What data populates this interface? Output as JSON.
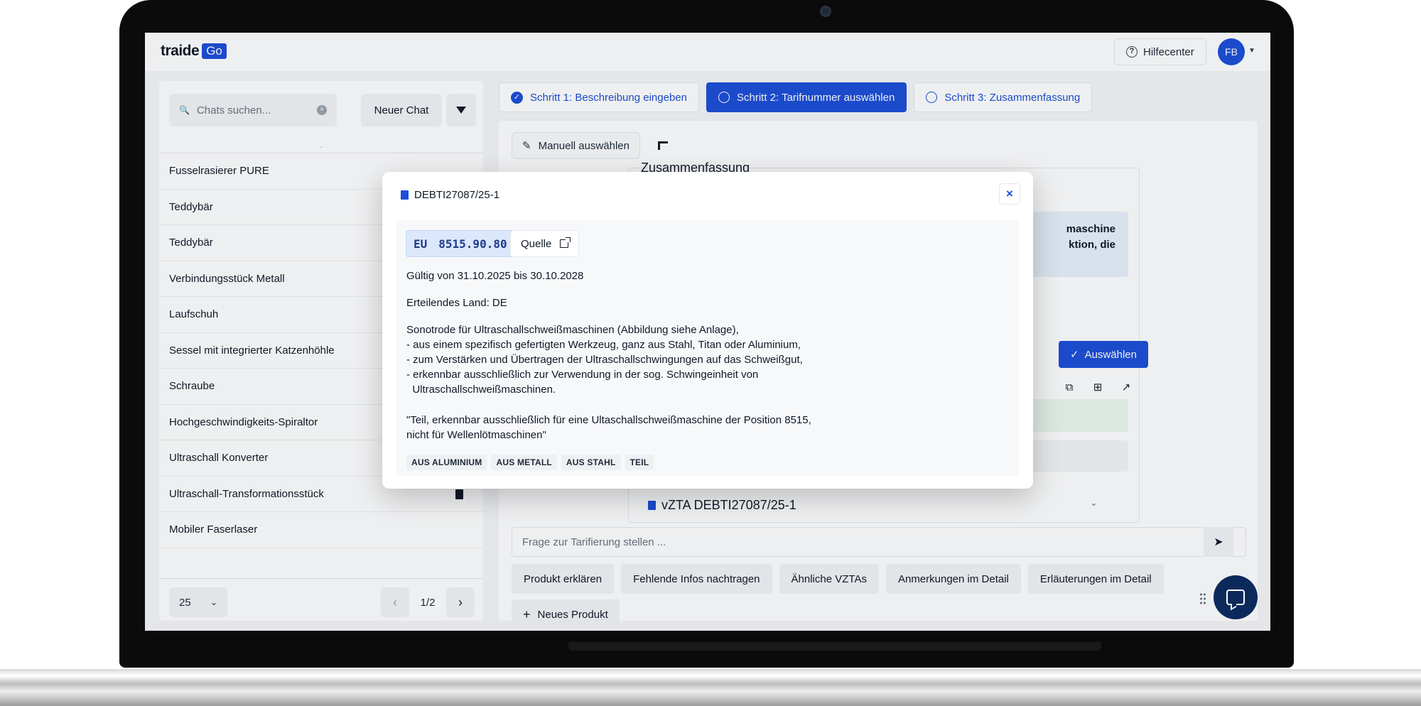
{
  "app": {
    "logo_text": "traide",
    "logo_badge": "Go"
  },
  "topbar": {
    "help_label": "Hilfecenter",
    "help_icon": "help-circle-icon",
    "avatar_initials": "FB"
  },
  "sidebar": {
    "search_placeholder": "Chats suchen...",
    "new_chat_label": "Neuer Chat",
    "chats": [
      "Fusselrasierer PURE",
      "Teddybär",
      "Teddybär",
      "Verbindungsstück Metall",
      "Laufschuh",
      "Sessel mit integrierter Katzenhöhle",
      "Schraube",
      "Hochgeschwindigkeits-Spiraltor",
      "Ultraschall Konverter",
      "Ultraschall-Transformationsstück",
      "Mobiler Faserlaser"
    ],
    "page_size": "25",
    "pagination": "1/2"
  },
  "steps": [
    {
      "label": "Schritt 1: Beschreibung eingeben",
      "state": "done"
    },
    {
      "label": "Schritt 2: Tarifnummer auswählen",
      "state": "active"
    },
    {
      "label": "Schritt 3: Zusammenfassung",
      "state": "pending"
    }
  ],
  "main": {
    "manual_select_label": "Manuell auswählen",
    "summary_heading": "Zusammenfassung",
    "blue_box_text": "maschine\nktion, die",
    "select_label": "Auswählen",
    "vzta_label": "vZTA DEBTI27087/25-1",
    "chat_input_placeholder": "Frage zur Tarifierung stellen ...",
    "suggestions": [
      "Produkt erklären",
      "Fehlende Infos nachtragen",
      "Ähnliche VZTAs",
      "Anmerkungen im Detail",
      "Erläuterungen im Detail"
    ],
    "new_product_label": "Neues Produkt"
  },
  "modal": {
    "title": "DEBTI27087/25-1",
    "region": "EU",
    "tariff_code": "8515.90.80",
    "source_label": "Quelle",
    "validity": "Gültig von 31.10.2025 bis 30.10.2028",
    "issuing_country": "Erteilendes Land: DE",
    "description": "Sonotrode für Ultraschallschweißmaschinen (Abbildung siehe Anlage),\n- aus einem spezifisch gefertigten Werkzeug, ganz aus Stahl, Titan oder Aluminium,\n- zum Verstärken und Übertragen der Ultraschallschwingungen auf das Schweißgut,\n- erkennbar ausschließlich zur Verwendung in der sog. Schwingeinheit von\n  Ultraschallschweißmaschinen.",
    "quote": "\"Teil, erkennbar ausschließlich für eine Ultaschallschweißmaschine der Position 8515,\nnicht für Wellenlötmaschinen\"",
    "tags": [
      "AUS ALUMINIUM",
      "AUS METALL",
      "AUS STAHL",
      "TEIL"
    ]
  },
  "colors": {
    "primary": "#1d4ed8",
    "fab": "#0b2a5b",
    "chip_bg": "#dbe7fb"
  }
}
